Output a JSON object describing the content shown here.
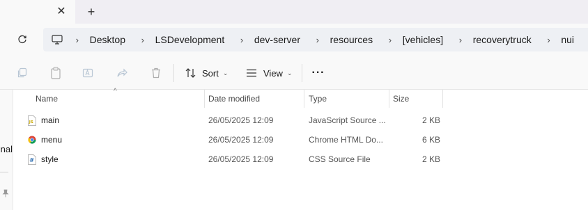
{
  "tabs": {
    "close_glyph": "✕",
    "new_tab_glyph": "+"
  },
  "address": {
    "crumbs": [
      "Desktop",
      "LSDevelopment",
      "dev-server",
      "resources",
      "[vehicles]",
      "recoverytruck",
      "nui"
    ],
    "separator": "›"
  },
  "toolbar": {
    "sort_label": "Sort",
    "view_label": "View",
    "more_label": "···",
    "caret": "⌄"
  },
  "navpane": {
    "partial_label": "nal"
  },
  "list": {
    "columns": {
      "name": "Name",
      "date": "Date modified",
      "type": "Type",
      "size": "Size"
    },
    "sort_indicator": "^",
    "rows": [
      {
        "name": "main",
        "date": "26/05/2025 12:09",
        "type": "JavaScript Source ...",
        "size": "2 KB",
        "icon": "javascript-file-icon"
      },
      {
        "name": "menu",
        "date": "26/05/2025 12:09",
        "type": "Chrome HTML Do...",
        "size": "6 KB",
        "icon": "chrome-html-file-icon"
      },
      {
        "name": "style",
        "date": "26/05/2025 12:09",
        "type": "CSS Source File",
        "size": "2 KB",
        "icon": "css-file-icon"
      }
    ]
  },
  "colors": {
    "accent": "#0067c0",
    "chrome_red": "#db4437",
    "chrome_yellow": "#f4c20d",
    "chrome_green": "#0f9d58"
  }
}
